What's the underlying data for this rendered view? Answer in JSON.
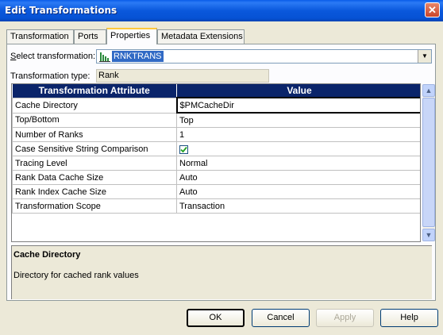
{
  "window": {
    "title": "Edit Transformations",
    "close_glyph": "✕"
  },
  "tabs": [
    {
      "label": "Transformation",
      "active": false
    },
    {
      "label": "Ports",
      "active": false
    },
    {
      "label": "Properties",
      "active": true
    },
    {
      "label": "Metadata Extensions",
      "active": false
    }
  ],
  "select_transformation": {
    "label_prefix": "S",
    "label_rest": "elect transformation:",
    "value": "RNKTRANS",
    "icon": "rank-transformation-icon"
  },
  "transformation_type": {
    "label": "Transformation type:",
    "value": "Rank"
  },
  "grid": {
    "columns": [
      "Transformation Attribute",
      "Value"
    ],
    "rows": [
      {
        "attribute": "Cache Directory",
        "value": "$PMCacheDir"
      },
      {
        "attribute": "Top/Bottom",
        "value": "Top"
      },
      {
        "attribute": "Number of Ranks",
        "value": "1"
      },
      {
        "attribute": "Case Sensitive String Comparison",
        "value": "",
        "checked": true
      },
      {
        "attribute": "Tracing Level",
        "value": "Normal"
      },
      {
        "attribute": "Rank Data Cache Size",
        "value": "Auto"
      },
      {
        "attribute": "Rank Index Cache Size",
        "value": "Auto"
      },
      {
        "attribute": "Transformation Scope",
        "value": "Transaction"
      }
    ]
  },
  "description": {
    "title": "Cache Directory",
    "text": "Directory for cached rank values"
  },
  "buttons": {
    "ok": "OK",
    "cancel": "Cancel",
    "apply": "Apply",
    "help": "Help"
  },
  "colors": {
    "header_bg": "#0a246a",
    "selection": "#316ac5"
  }
}
